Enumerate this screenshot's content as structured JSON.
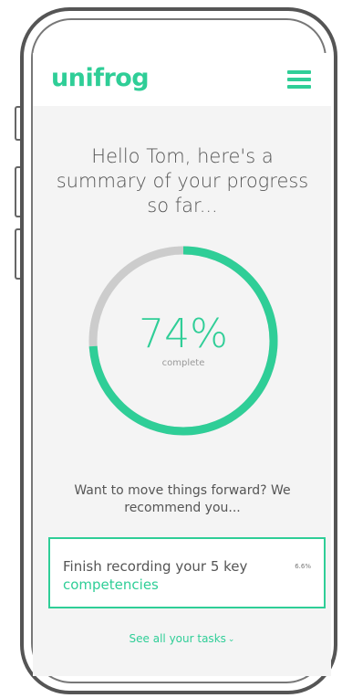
{
  "header": {
    "logo": "unifrog",
    "menu_icon": "hamburger-menu-icon",
    "accent_color": "#2fce97"
  },
  "greeting": {
    "text": "Hello Tom, here's a summary of your progress so far..."
  },
  "progress": {
    "value": 74,
    "percent_text": "74%",
    "label": "complete",
    "fill_color": "#2fce97",
    "track_color": "#cccccc"
  },
  "recommendation": {
    "text": "Want to move things forward? We recommend you..."
  },
  "task": {
    "title": "Finish recording your 5 key",
    "link": "competencies",
    "percent": "6.6%"
  },
  "footer": {
    "see_all": "See all your tasks",
    "chevron_icon": "chevron-down-icon"
  }
}
